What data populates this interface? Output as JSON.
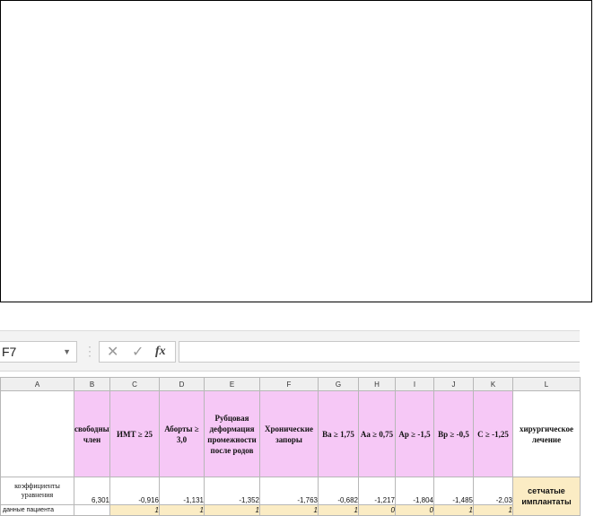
{
  "formula_bar": {
    "cell_ref": "F7",
    "cancel_icon": "cancel-icon",
    "confirm_icon": "confirm-icon",
    "fx_label": "fx",
    "formula": ""
  },
  "columns": [
    "A",
    "B",
    "C",
    "D",
    "E",
    "F",
    "G",
    "H",
    "I",
    "J",
    "K",
    "L"
  ],
  "headers": {
    "B": "свободный член",
    "C": "ИМТ ≥ 25",
    "D": "Аборты ≥ 3,0",
    "E": "Рубцовая деформация промежности после родов",
    "F": "Хронические запоры",
    "G": "Ba ≥ 1,75",
    "H": "Aa ≥ 0,75",
    "I": "Ap ≥ -1,5",
    "J": "Bp ≥ -0,5",
    "K": "C ≥ -1,25",
    "L": "хирургическое лечение"
  },
  "coefficients_row": {
    "label": "коэффициенты уравнения",
    "values": [
      "6,301",
      "-0,916",
      "-1,131",
      "-1,352",
      "-1,763",
      "-0,682",
      "-1,217",
      "-1,804",
      "-1,485",
      "-2,03"
    ],
    "result": "сетчатые имплантаты"
  },
  "patient_row": {
    "label": "данные пациента",
    "values": [
      "1",
      "1",
      "1",
      "1",
      "1",
      "0",
      "0",
      "1",
      "1"
    ]
  },
  "colors": {
    "header_fill": "#f6c8f6",
    "input_fill": "#fbecc4"
  }
}
